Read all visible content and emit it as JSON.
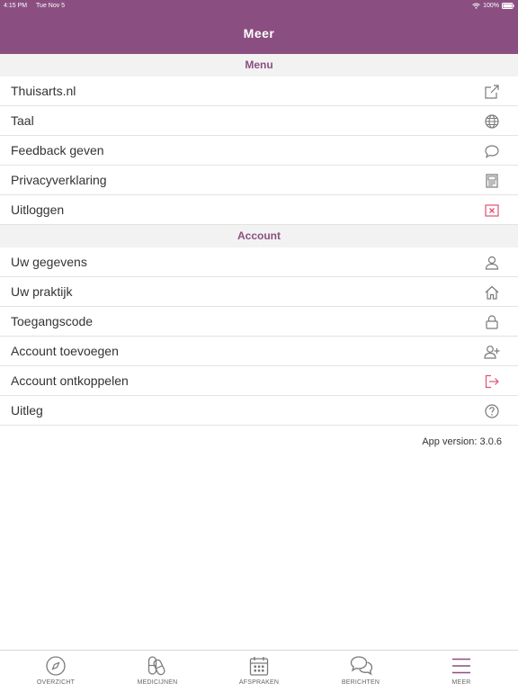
{
  "status_bar": {
    "time": "4:15 PM",
    "date": "Tue Nov 5",
    "battery": "100%"
  },
  "header": {
    "title": "Meer"
  },
  "sections": {
    "menu": {
      "title": "Menu",
      "items": [
        {
          "label": "Thuisarts.nl",
          "icon": "external-link-icon"
        },
        {
          "label": "Taal",
          "icon": "globe-icon"
        },
        {
          "label": "Feedback geven",
          "icon": "chat-bubble-icon"
        },
        {
          "label": "Privacyverklaring",
          "icon": "document-icon"
        },
        {
          "label": "Uitloggen",
          "icon": "close-box-icon"
        }
      ]
    },
    "account": {
      "title": "Account",
      "items": [
        {
          "label": "Uw gegevens",
          "icon": "user-icon"
        },
        {
          "label": "Uw praktijk",
          "icon": "home-icon"
        },
        {
          "label": "Toegangscode",
          "icon": "lock-icon"
        },
        {
          "label": "Account toevoegen",
          "icon": "add-user-icon"
        },
        {
          "label": "Account ontkoppelen",
          "icon": "logout-icon"
        },
        {
          "label": "Uitleg",
          "icon": "help-icon"
        }
      ]
    }
  },
  "app_version": "App version: 3.0.6",
  "tabs": [
    {
      "label": "OVERZICHT",
      "icon": "compass-icon"
    },
    {
      "label": "MEDICIJNEN",
      "icon": "pills-icon"
    },
    {
      "label": "AFSPRAKEN",
      "icon": "calendar-icon"
    },
    {
      "label": "BERICHTEN",
      "icon": "messages-icon"
    },
    {
      "label": "MEER",
      "icon": "menu-icon"
    }
  ],
  "colors": {
    "brand": "#8a4f80",
    "danger": "#e0516e",
    "icon": "#7a7a7a"
  }
}
